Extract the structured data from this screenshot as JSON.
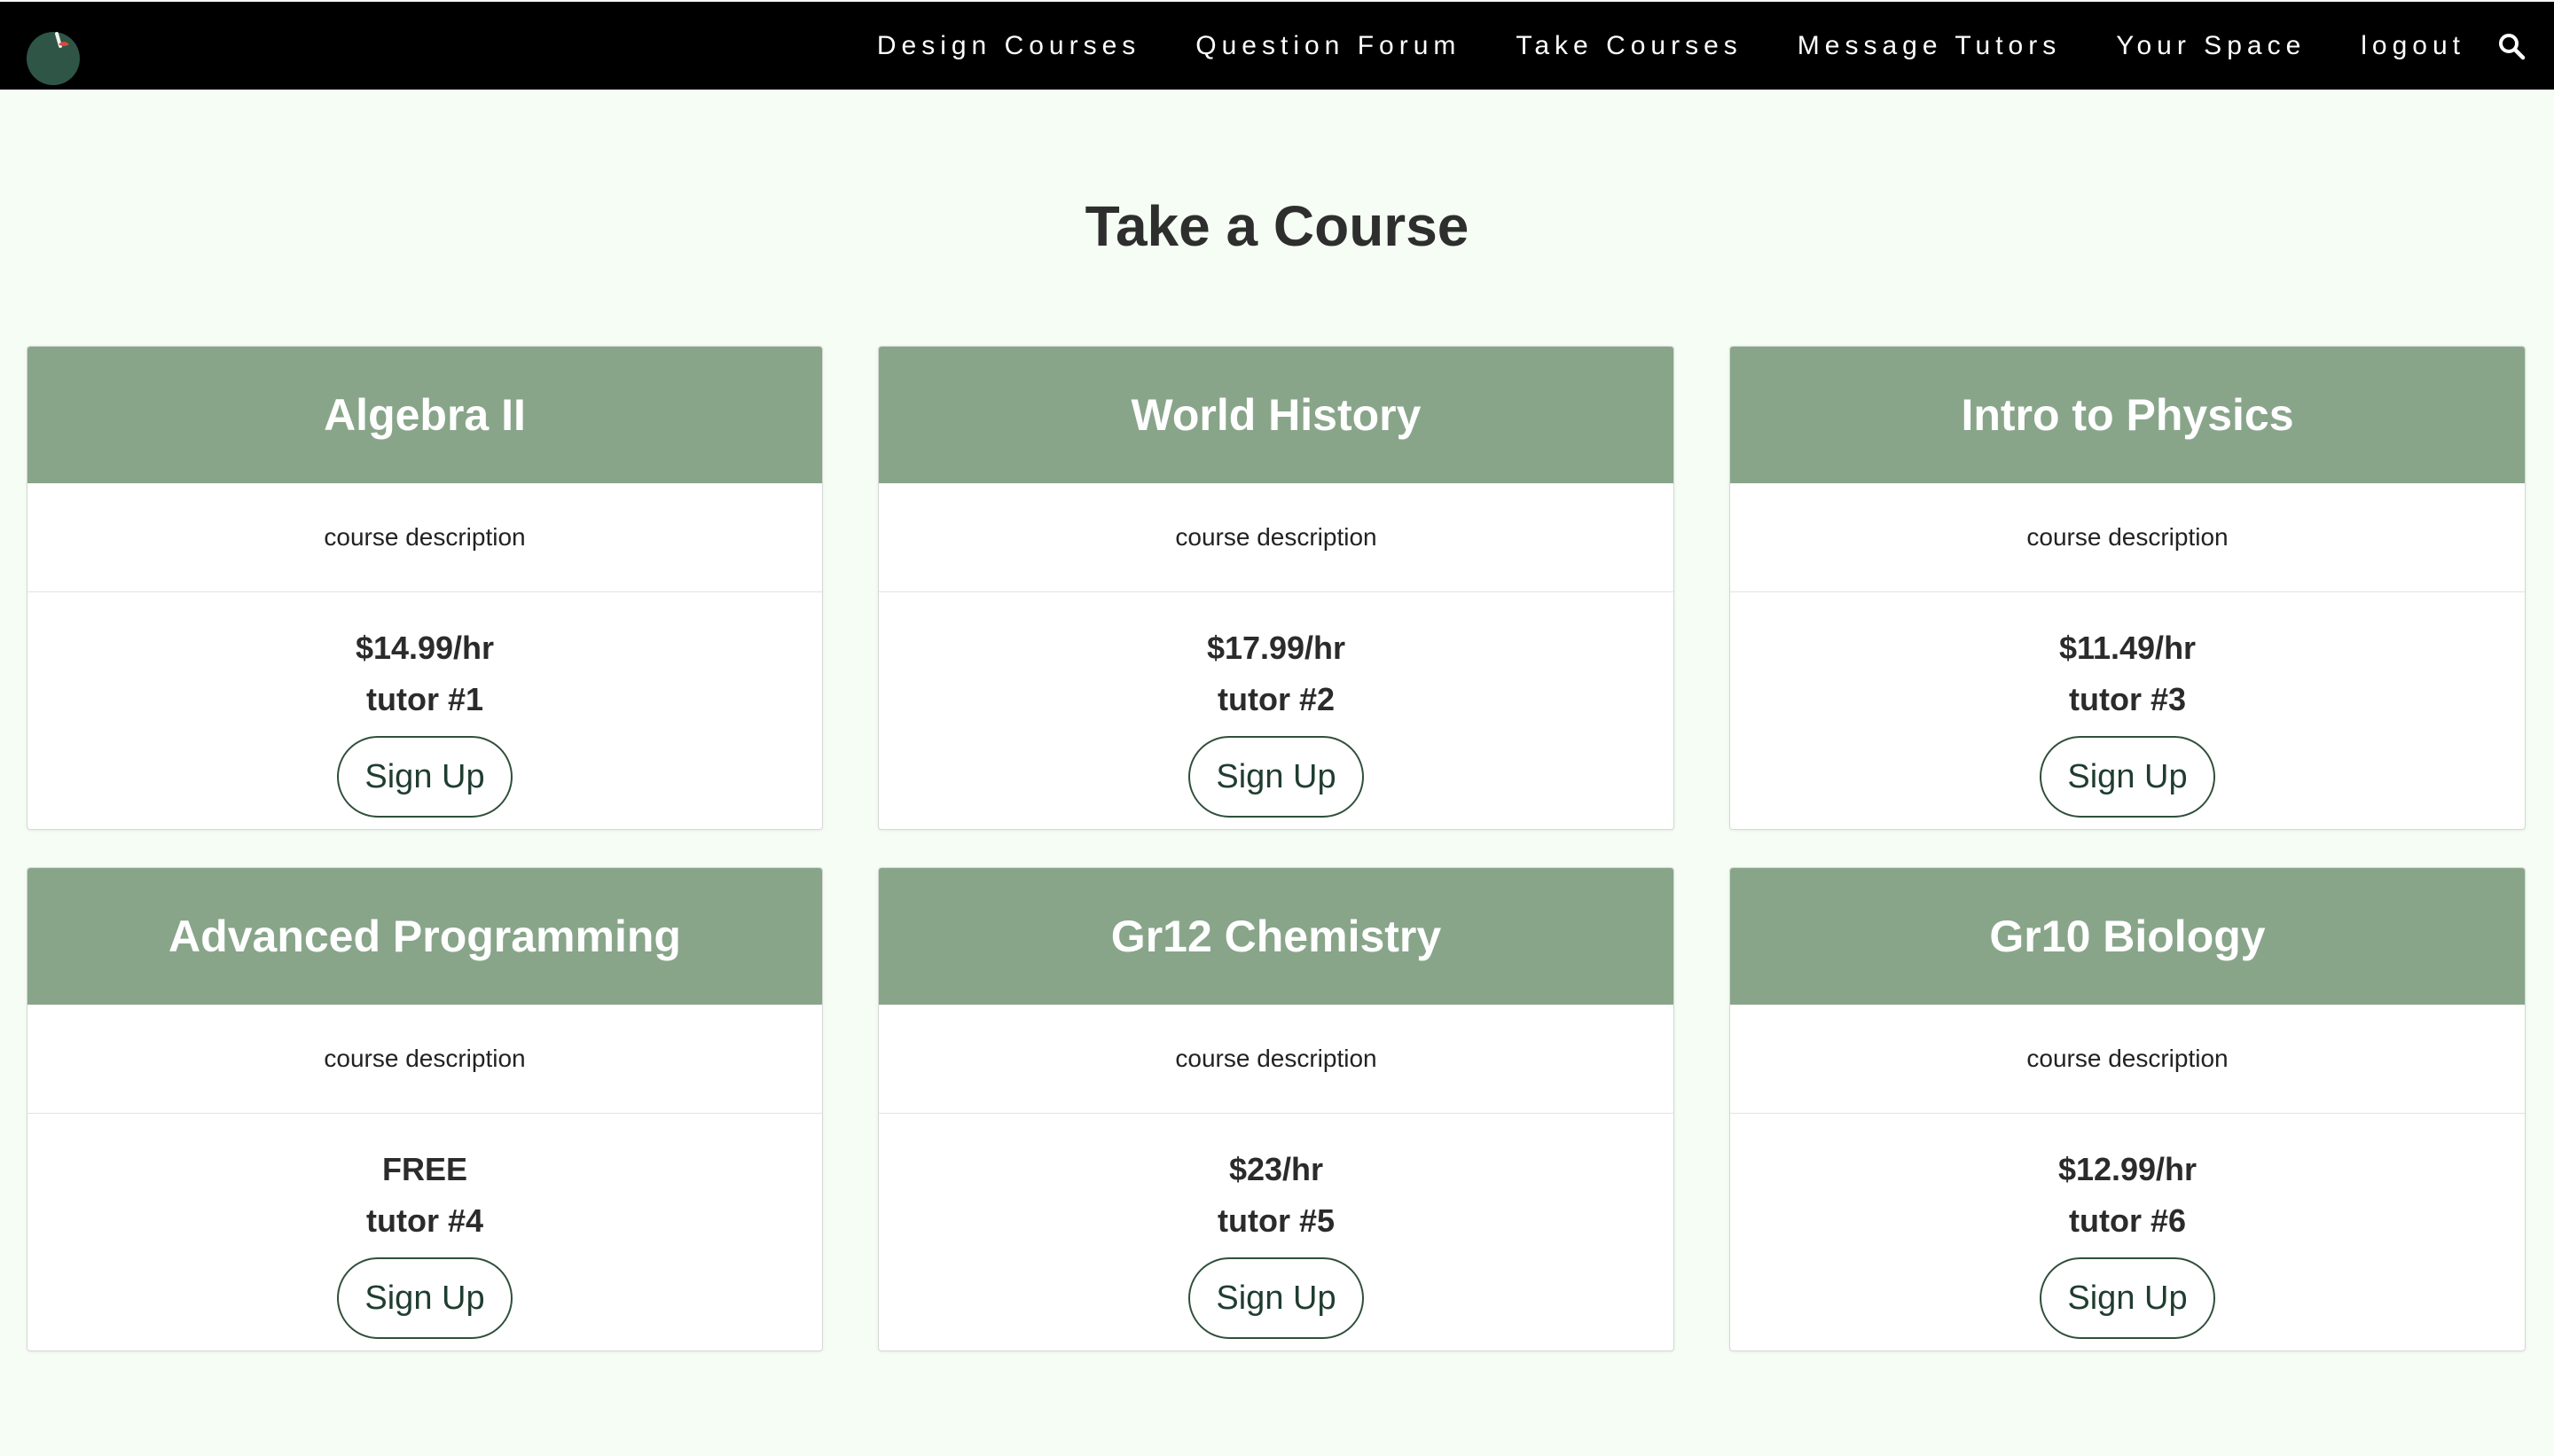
{
  "nav": {
    "links": [
      {
        "label": "Design Courses"
      },
      {
        "label": "Question Forum"
      },
      {
        "label": "Take Courses"
      },
      {
        "label": "Message Tutors"
      },
      {
        "label": "Your Space"
      },
      {
        "label": "logout"
      }
    ],
    "search_icon": "search-icon",
    "logo_icon": "apple-logo-icon"
  },
  "page": {
    "title": "Take a Course"
  },
  "courses": [
    {
      "title": "Algebra II",
      "description": "course description",
      "price": "$14.99/hr",
      "tutor": "tutor #1",
      "button": "Sign Up"
    },
    {
      "title": "World History",
      "description": "course description",
      "price": "$17.99/hr",
      "tutor": "tutor #2",
      "button": "Sign Up"
    },
    {
      "title": "Intro to Physics",
      "description": "course description",
      "price": "$11.49/hr",
      "tutor": "tutor #3",
      "button": "Sign Up"
    },
    {
      "title": "Advanced Programming",
      "description": "course description",
      "price": "FREE",
      "tutor": "tutor #4",
      "button": "Sign Up"
    },
    {
      "title": "Gr12 Chemistry",
      "description": "course description",
      "price": "$23/hr",
      "tutor": "tutor #5",
      "button": "Sign Up"
    },
    {
      "title": "Gr10 Biology",
      "description": "course description",
      "price": "$12.99/hr",
      "tutor": "tutor #6",
      "button": "Sign Up"
    }
  ],
  "colors": {
    "nav_bg": "#000000",
    "page_bg": "#f5fdf4",
    "card_header_bg": "#88a58a",
    "button_border": "#2f4f3a"
  }
}
